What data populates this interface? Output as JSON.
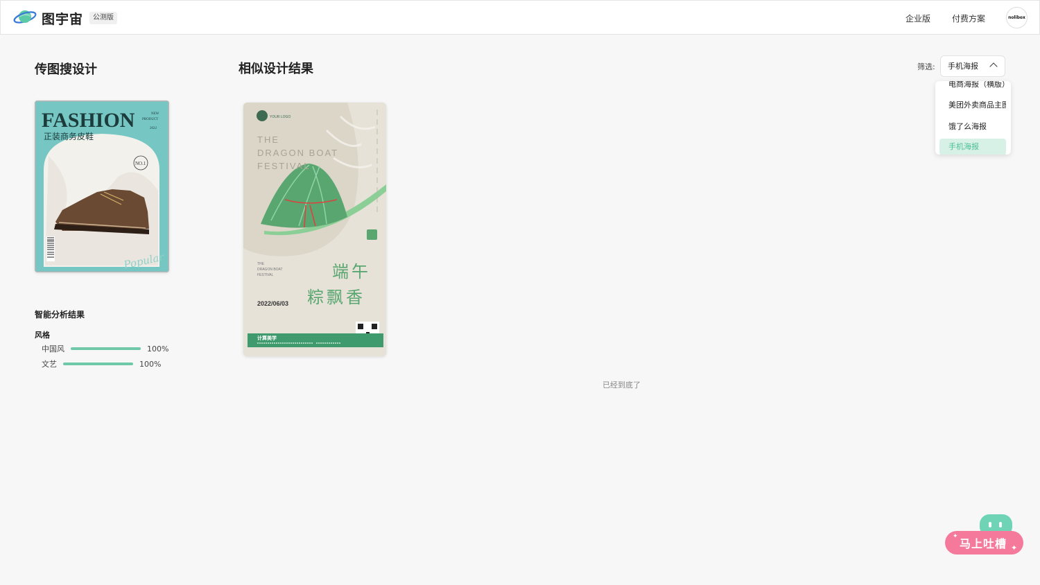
{
  "header": {
    "brand": "图宇宙",
    "badge": "公测版",
    "nav": [
      "企业版",
      "付费方案"
    ],
    "avatar_text": "nolibox"
  },
  "left": {
    "title": "传图搜设计",
    "upload_image": {
      "headline": "FASHION",
      "tag": "NEW PRODUCT",
      "year": "2022",
      "subtitle": "正装商务皮鞋",
      "badge": "NO.1",
      "script": "Popular"
    },
    "analysis_title": "智能分析结果",
    "style_label": "风格",
    "styles": [
      {
        "name": "中国风",
        "value": "100%",
        "fraction": 1.0
      },
      {
        "name": "文艺",
        "value": "100%",
        "fraction": 1.0
      }
    ]
  },
  "results": {
    "title": "相似设计结果",
    "items": [
      {
        "logo": "YOUR LOGO",
        "english_title": "THE DRAGON BOAT FESTIVAL",
        "small_english": "THE DRAGON BOAT FESTIVAL",
        "date": "2022/06/03",
        "headline_1": "端午",
        "headline_2": "粽飘香",
        "vertical_text": "一年一端午一岁一安康",
        "seal": "五月初五",
        "footer_brand": "计算美学",
        "footer_address": "地址：图宇宙市繁荣区大街",
        "footer_phone": "电话：010-82366623"
      }
    ],
    "end_text": "已经到底了"
  },
  "filter": {
    "label": "筛选:",
    "selected": "手机海报",
    "options": [
      "电商海报（横版）",
      "美团外卖商品主图",
      "饿了么海报",
      "手机海报"
    ]
  },
  "feedback": {
    "label": "马上吐槽"
  },
  "colors": {
    "accent": "#6fc9a8",
    "selected_text": "#4cbf96",
    "feedback_pink": "#f4799a",
    "poster_green": "#3f9a6e",
    "fashion_teal": "#76c6c3"
  }
}
